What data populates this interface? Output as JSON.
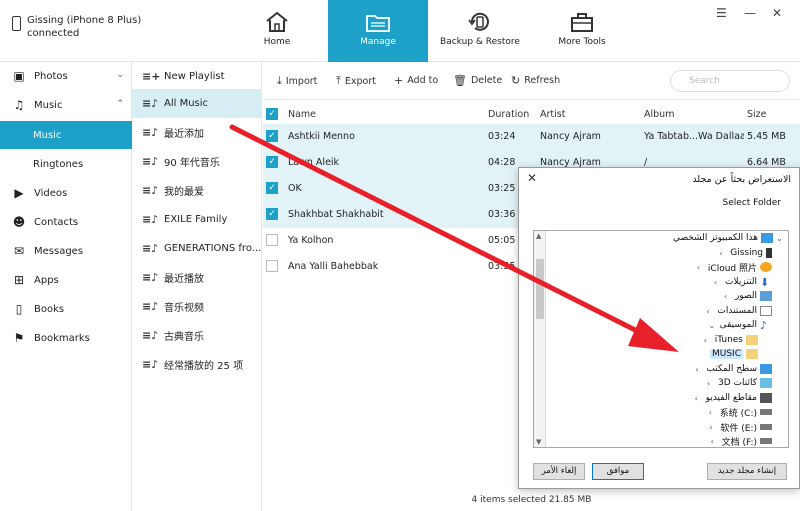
{
  "device": {
    "name": "Gissing (iPhone 8 Plus)",
    "status": "connected"
  },
  "nav": [
    {
      "label": "Home",
      "icon": "home-icon"
    },
    {
      "label": "Manage",
      "icon": "folder-icon"
    },
    {
      "label": "Backup & Restore",
      "icon": "backup-icon"
    },
    {
      "label": "More Tools",
      "icon": "toolbox-icon"
    }
  ],
  "sidebar": {
    "items": [
      {
        "label": "Photos",
        "icon": "photos-icon"
      },
      {
        "label": "Music",
        "icon": "music-icon"
      },
      {
        "label": "Music"
      },
      {
        "label": "Ringtones"
      },
      {
        "label": "Videos",
        "icon": "video-icon"
      },
      {
        "label": "Contacts",
        "icon": "contacts-icon"
      },
      {
        "label": "Messages",
        "icon": "messages-icon"
      },
      {
        "label": "Apps",
        "icon": "apps-icon"
      },
      {
        "label": "Books",
        "icon": "books-icon"
      },
      {
        "label": "Bookmarks",
        "icon": "bookmarks-icon"
      }
    ]
  },
  "playlists": {
    "new_label": "New Playlist",
    "items": [
      "All Music",
      "最近添加",
      "90 年代音乐",
      "我的最爱",
      "EXILE Family",
      "GENERATIONS fro...",
      "最近播放",
      "音乐视频",
      "古典音乐",
      "经常播放的 25 项"
    ]
  },
  "toolbar": {
    "import": "Import",
    "export": "Export",
    "add": "Add to",
    "delete": "Delete",
    "refresh": "Refresh",
    "search_placeholder": "Search"
  },
  "table": {
    "headers": [
      "Name",
      "Duration",
      "Artist",
      "Album",
      "Size"
    ],
    "rows": [
      {
        "name": "Ashtkii Menno",
        "duration": "03:24",
        "artist": "Nancy Ajram",
        "album": "Ya Tabtab...Wa Dallaa",
        "size": "5.45 MB",
        "checked": true
      },
      {
        "name": "Lawn Aleik",
        "duration": "04:28",
        "artist": "Nancy Ajram",
        "album": "/",
        "size": "6.64 MB",
        "checked": true
      },
      {
        "name": "OK",
        "duration": "03:25",
        "artist": "",
        "album": "",
        "size": "",
        "checked": true
      },
      {
        "name": "Shakhbat Shakhabit",
        "duration": "03:36",
        "artist": "",
        "album": "",
        "size": "",
        "checked": true
      },
      {
        "name": "Ya Kolhon",
        "duration": "05:05",
        "artist": "",
        "album": "",
        "size": "",
        "checked": false
      },
      {
        "name": "Ana Yalli Bahebbak",
        "duration": "03:55",
        "artist": "",
        "album": "",
        "size": "",
        "checked": false
      }
    ]
  },
  "status": "4 items selected 21.85 MB",
  "dialog": {
    "title": "الاستعراض بحثاً عن مجلد",
    "subtitle": "Select Folder",
    "tree": [
      {
        "label": "هذا الكمبيوتر الشخصي",
        "icon": "computer-icon"
      },
      {
        "label": "Gissing",
        "icon": "phone-icon"
      },
      {
        "label": "iCloud 照片",
        "icon": "icloud-icon"
      },
      {
        "label": "التنزيلات",
        "icon": "download-icon"
      },
      {
        "label": "الصور",
        "icon": "pictures-icon"
      },
      {
        "label": "المستندات",
        "icon": "documents-icon"
      },
      {
        "label": "الموسيقى",
        "icon": "music-note-icon"
      },
      {
        "label": "iTunes",
        "icon": "folder-icon"
      },
      {
        "label": "MUSIC",
        "icon": "folder-icon"
      },
      {
        "label": "سطح المكتب",
        "icon": "desktop-icon"
      },
      {
        "label": "3D كائنات",
        "icon": "3d-icon"
      },
      {
        "label": "مقاطع الفيديو",
        "icon": "video-icon"
      },
      {
        "label": "系统 (C:)",
        "icon": "drive-icon"
      },
      {
        "label": "软件 (E:)",
        "icon": "drive-icon"
      },
      {
        "label": "文档 (F:)",
        "icon": "drive-icon"
      }
    ],
    "buttons": {
      "cancel": "إلغاء الأمر",
      "ok": "موافق",
      "new_folder": "إنشاء مجلد جديد"
    }
  },
  "colors": {
    "accent": "#1da1c8",
    "arrow": "#e8202a",
    "selected_row": "#e2f3f8"
  }
}
